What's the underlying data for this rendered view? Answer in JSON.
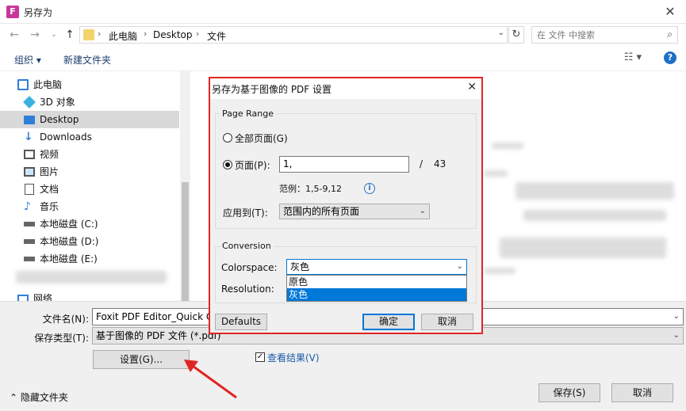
{
  "window": {
    "title": "另存为",
    "app_icon_letter": "F",
    "close_glyph": "✕"
  },
  "nav": {
    "back": "←",
    "forward": "→",
    "recent": "⌄",
    "up": "↑",
    "breadcrumb": [
      "此电脑",
      "Desktop",
      "文件"
    ],
    "separator": "›",
    "dropdown": "⌄",
    "refresh": "↻",
    "search_placeholder": "在 文件 中搜索",
    "search_icon": "⌕"
  },
  "toolbar": {
    "organize": "组织 ▾",
    "new_folder": "新建文件夹",
    "view_glyph": "☷ ▾",
    "help": "?"
  },
  "sidebar": {
    "items": [
      {
        "label": "此电脑",
        "icon": "computer-icon",
        "color": "#2f7fd6"
      },
      {
        "label": "3D 对象",
        "icon": "cube-3d-icon",
        "color": "#3ab0e0"
      },
      {
        "label": "Desktop",
        "icon": "desktop-icon",
        "color": "#2f7fd6"
      },
      {
        "label": "Downloads",
        "icon": "download-icon",
        "color": "#2f7fd6"
      },
      {
        "label": "视频",
        "icon": "video-icon",
        "color": "#555555"
      },
      {
        "label": "图片",
        "icon": "picture-icon",
        "color": "#555555"
      },
      {
        "label": "文档",
        "icon": "document-icon",
        "color": "#555555"
      },
      {
        "label": "音乐",
        "icon": "music-icon",
        "color": "#2f7fd6"
      },
      {
        "label": "本地磁盘 (C:)",
        "icon": "drive-icon",
        "color": "#666666"
      },
      {
        "label": "本地磁盘 (D:)",
        "icon": "drive-icon",
        "color": "#666666"
      },
      {
        "label": "本地磁盘 (E:)",
        "icon": "drive-icon",
        "color": "#666666"
      },
      {
        "label": "网络",
        "icon": "network-icon",
        "color": "#2f7fd6"
      }
    ],
    "selected_index": 2
  },
  "form": {
    "filename_label": "文件名(N):",
    "filename_value": "Foxit PDF Editor_Quick Gui",
    "filetype_label": "保存类型(T):",
    "filetype_value": "基于图像的 PDF 文件 (*.pdf)",
    "settings_button": "设置(G)...",
    "view_result_label": "查看结果(V)",
    "view_result_checked": "✓",
    "hide_folders": "隐藏文件夹",
    "save_button": "保存(S)",
    "cancel_button": "取消",
    "dropdown": "⌄"
  },
  "modal": {
    "title": "另存为基于图像的 PDF 设置",
    "close_glyph": "✕",
    "page_range": {
      "group_title": "Page Range",
      "all_pages": "全部页面(G)",
      "pages": "页面(P):",
      "pages_value": "1,",
      "total_sep": "/",
      "total_pages": "43",
      "example": "范例：1,5-9,12",
      "info_glyph": "i",
      "apply_to_label": "应用到(T):",
      "apply_to_value": "范围内的所有页面"
    },
    "conversion": {
      "group_title": "Conversion",
      "colorspace_label": "Colorspace:",
      "colorspace_value": "灰色",
      "resolution_label": "Resolution:",
      "options": [
        "原色",
        "灰色"
      ],
      "selected_option": 1
    },
    "defaults_button": "Defaults",
    "ok_button": "确定",
    "cancel_button": "取消",
    "dropdown": "⌄"
  },
  "colors": {
    "highlight_border": "#e02424",
    "selection": "#0078d7",
    "accent": "#2f7fd6"
  }
}
